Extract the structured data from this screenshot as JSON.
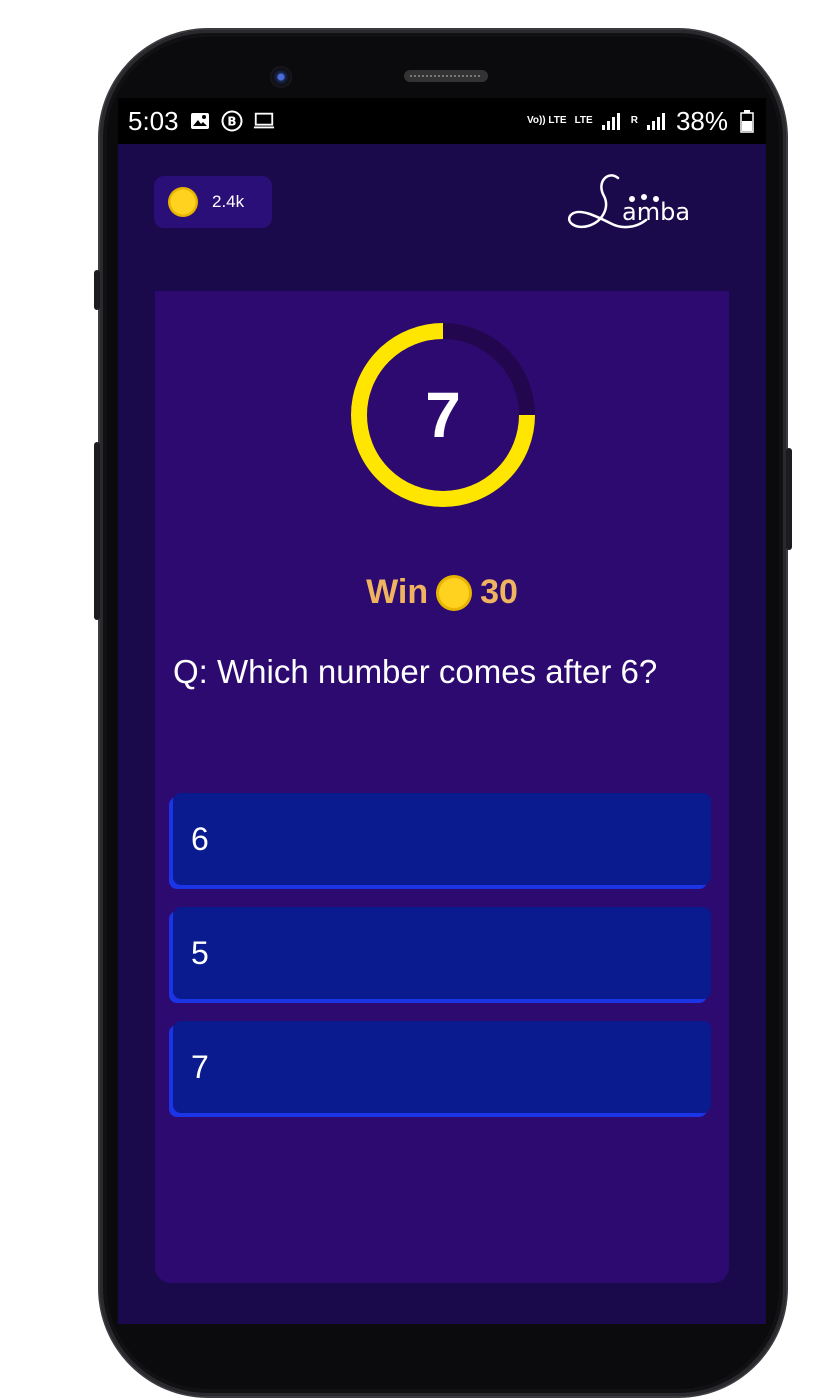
{
  "status_bar": {
    "time": "5:03",
    "icons": [
      "image-icon",
      "b-circle-icon",
      "laptop-icon"
    ],
    "network_label": "Vo)) LTE",
    "lte_label": "LTE",
    "roaming_label": "R",
    "battery": "38%"
  },
  "header": {
    "coins": "2.4k",
    "logo_text": "Lamba"
  },
  "quiz": {
    "timer": "7",
    "timer_progress": 0.75,
    "reward_prefix": "Win",
    "reward_amount": "30",
    "question": "Q: Which number comes after 6?",
    "options": [
      {
        "label": "6"
      },
      {
        "label": "5"
      },
      {
        "label": "7"
      }
    ]
  },
  "colors": {
    "background": "#1a0a4c",
    "card": "#2d0a70",
    "timer_ring": "#ffe600",
    "reward": "#f0b460",
    "option": "#0a1a8f",
    "option_edge": "#1a34e6"
  }
}
